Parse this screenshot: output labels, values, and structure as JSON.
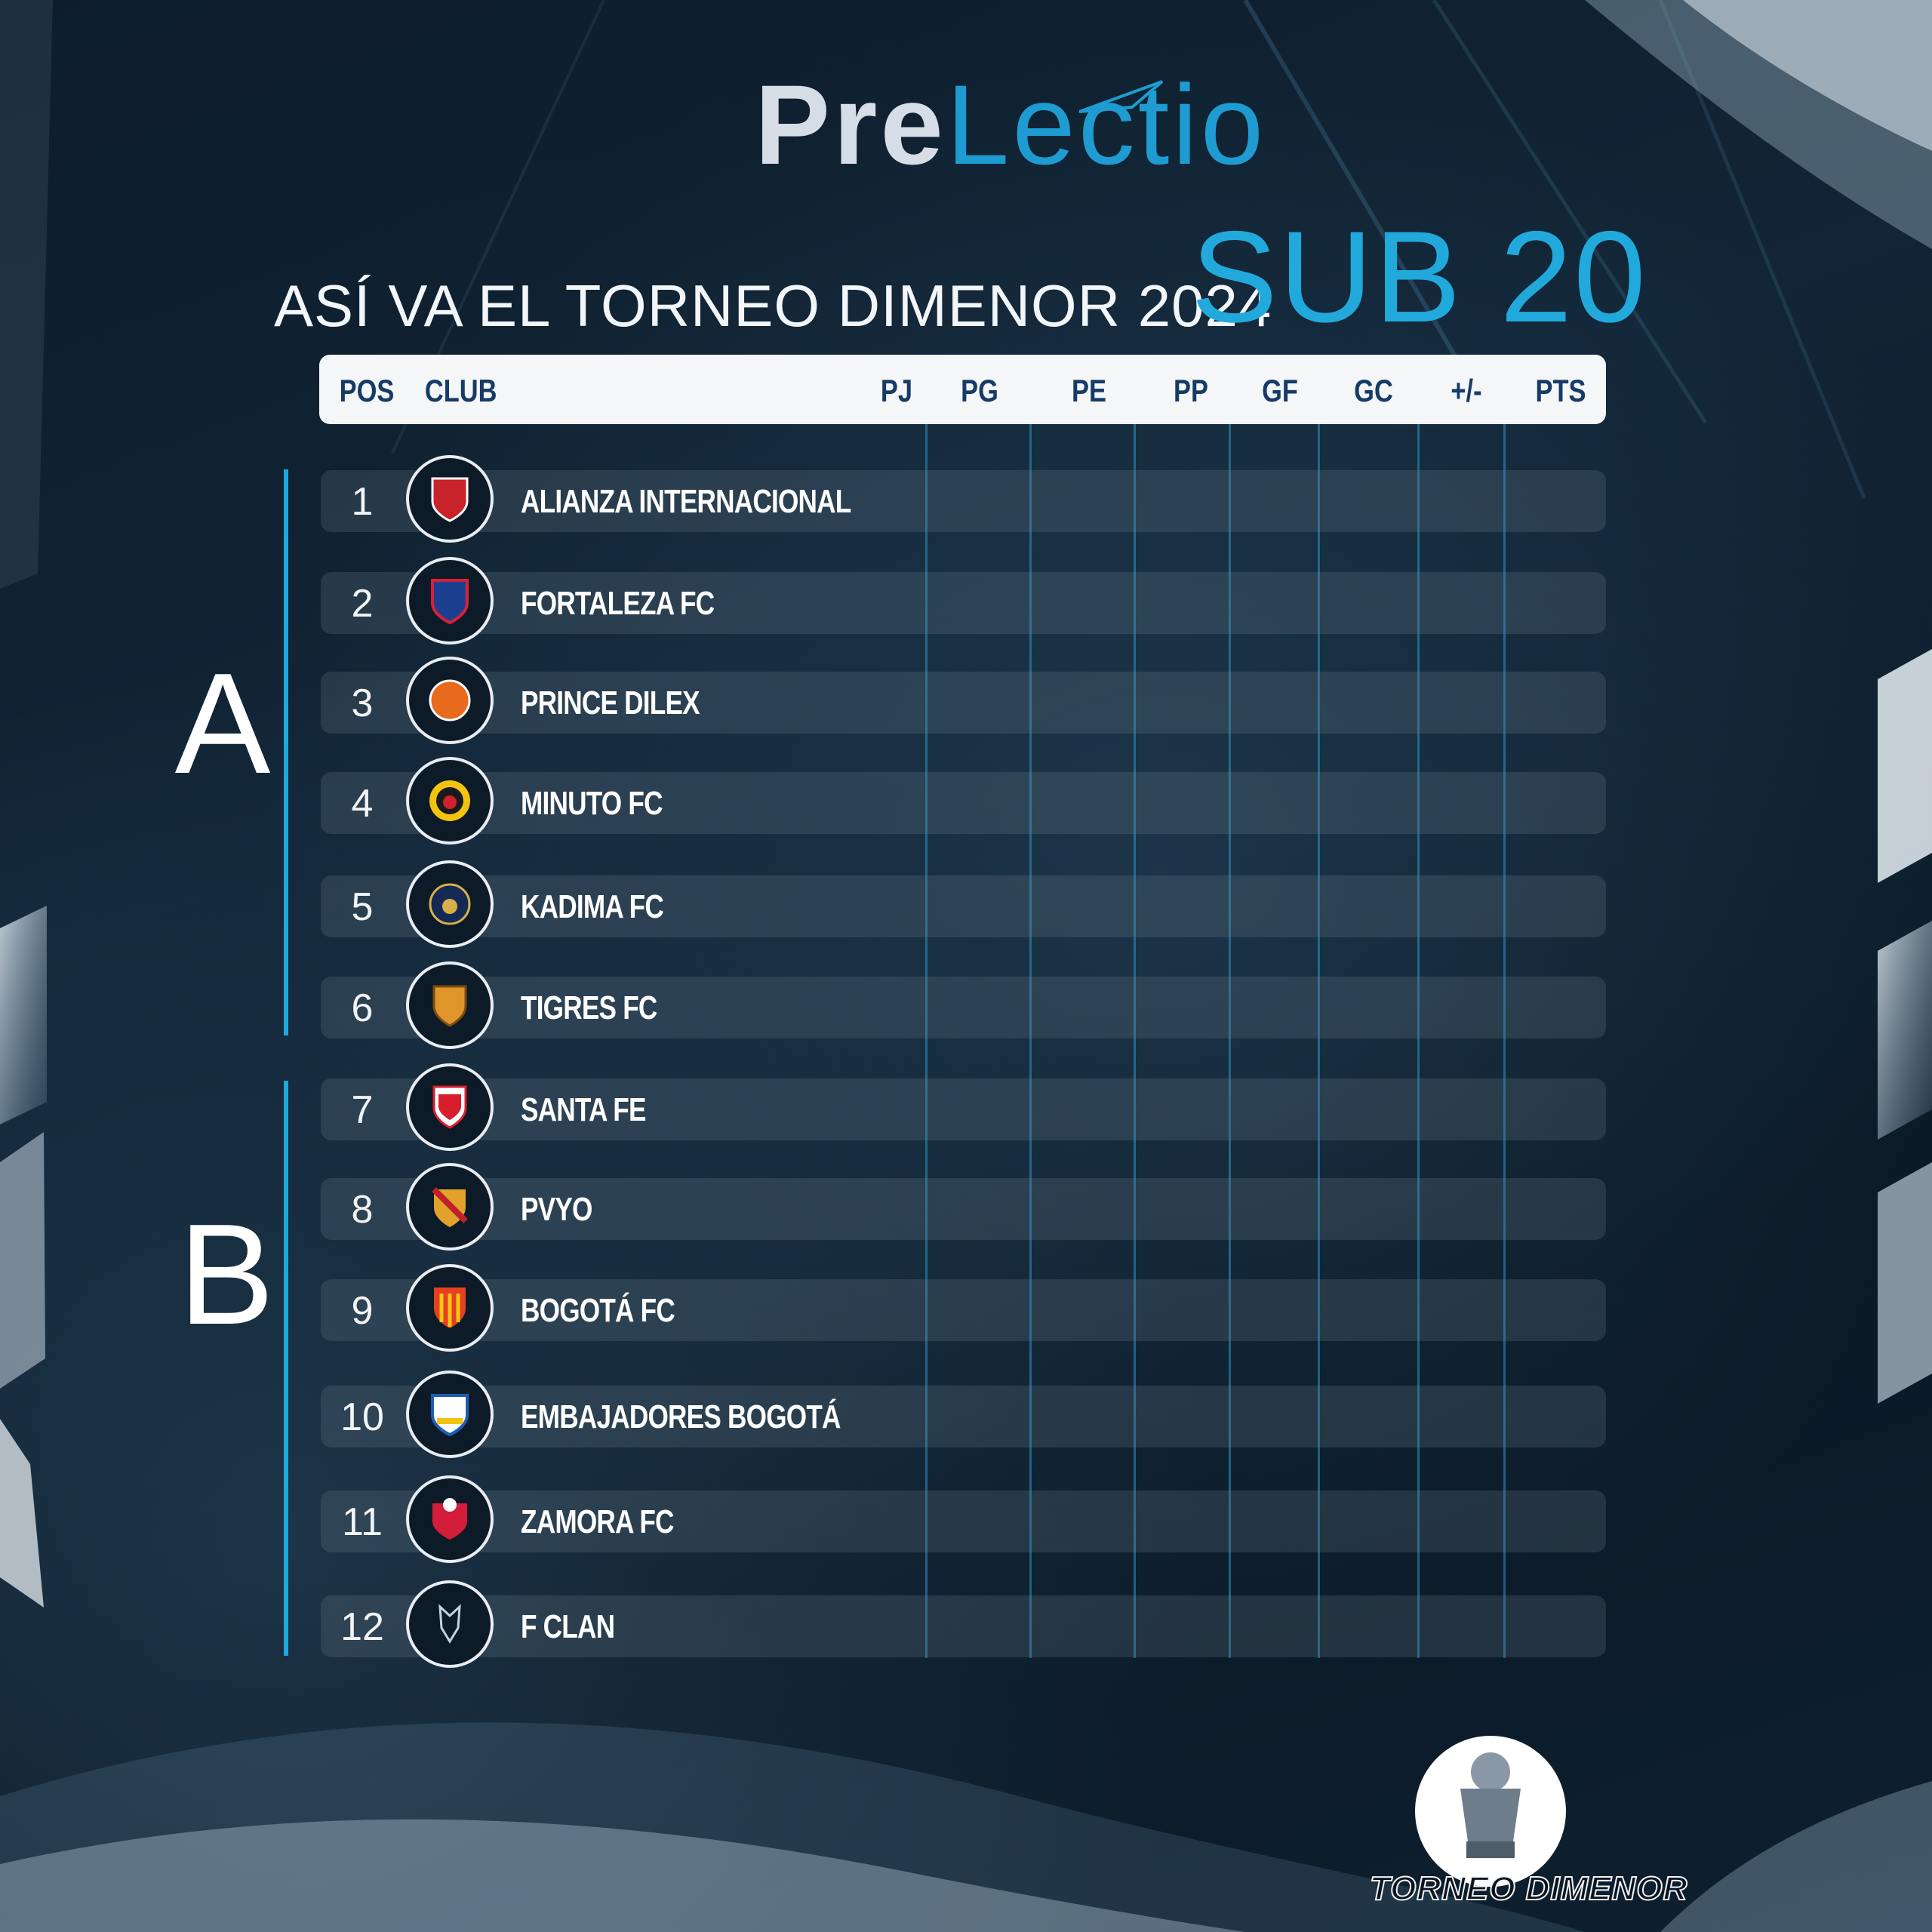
{
  "brand": {
    "prefix": "Pre",
    "suffix": "Lectio"
  },
  "subtitle": "ASÍ VA EL TORNEO DIMENOR 2024",
  "category": "SUB 20",
  "table": {
    "columns": [
      "POS",
      "CLUB",
      "PJ",
      "PG",
      "PE",
      "PP",
      "GF",
      "GC",
      "+/-",
      "PTS"
    ],
    "groups": [
      {
        "letter": "A"
      },
      {
        "letter": "B"
      }
    ],
    "rows": [
      {
        "pos": "1",
        "team": "ALIANZA INTERNACIONAL",
        "crest_color": "#c8222b"
      },
      {
        "pos": "2",
        "team": "FORTALEZA FC",
        "crest_color": "#1c3f8f"
      },
      {
        "pos": "3",
        "team": "PRINCE DILEX",
        "crest_color": "#e86a1d"
      },
      {
        "pos": "4",
        "team": "MINUTO FC",
        "crest_color": "#f1c40f"
      },
      {
        "pos": "5",
        "team": "KADIMA FC",
        "crest_color": "#d8b04a"
      },
      {
        "pos": "6",
        "team": "TIGRES FC",
        "crest_color": "#e0952a"
      },
      {
        "pos": "7",
        "team": "SANTA FE",
        "crest_color": "#d81e2c"
      },
      {
        "pos": "8",
        "team": "PVYO",
        "crest_color": "#e2a12b"
      },
      {
        "pos": "9",
        "team": "BOGOTÁ FC",
        "crest_color": "#e5401f"
      },
      {
        "pos": "10",
        "team": "EMBAJADORES BOGOTÁ",
        "crest_color": "#1a5fb4"
      },
      {
        "pos": "11",
        "team": "ZAMORA FC",
        "crest_color": "#d31d3a"
      },
      {
        "pos": "12",
        "team": "F CLAN",
        "crest_color": "#c9d2dc"
      }
    ]
  },
  "footer_logo": {
    "text": "TORNEO DIMENOR"
  },
  "colors": {
    "accent": "#1ea8de",
    "header_text": "#163b66",
    "background": "#0f2130"
  }
}
